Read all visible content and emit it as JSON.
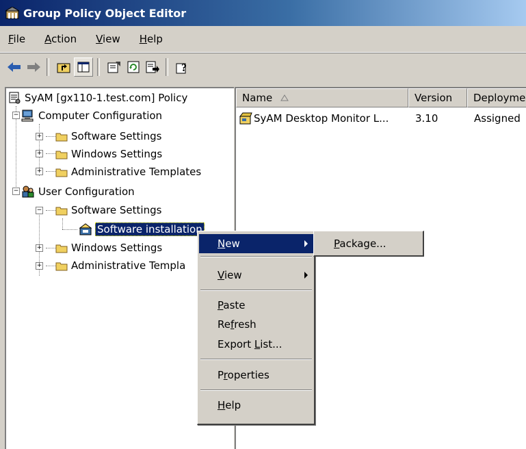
{
  "window": {
    "title": "Group Policy Object Editor"
  },
  "menubar": {
    "file": {
      "pre": "",
      "u": "F",
      "post": "ile"
    },
    "action": {
      "pre": "",
      "u": "A",
      "post": "ction"
    },
    "view": {
      "pre": "",
      "u": "V",
      "post": "iew"
    },
    "help": {
      "pre": "",
      "u": "H",
      "post": "elp"
    }
  },
  "toolbar": {
    "buttons": [
      "back-icon",
      "forward-icon",
      "up-level-icon",
      "show-hide-tree-icon",
      "properties-icon",
      "refresh-icon",
      "export-list-icon",
      "help-icon"
    ]
  },
  "tree": {
    "root": "SyAM [gx110-1.test.com] Policy",
    "computer_config": "Computer Configuration",
    "cc_software": "Software Settings",
    "cc_windows": "Windows Settings",
    "cc_admin": "Administrative Templates",
    "user_config": "User Configuration",
    "uc_software": "Software Settings",
    "uc_software_install": "Software installation",
    "uc_windows": "Windows Settings",
    "uc_admin": "Administrative Templa"
  },
  "list": {
    "columns": {
      "name": "Name",
      "version": "Version",
      "deployment": "Deployme"
    },
    "rows": [
      {
        "name": "SyAM Desktop Monitor L...",
        "version": "3.10",
        "deployment": "Assigned"
      }
    ]
  },
  "context_menu": {
    "new": {
      "pre": "",
      "u": "N",
      "post": "ew"
    },
    "view": {
      "pre": "",
      "u": "V",
      "post": "iew"
    },
    "paste": {
      "pre": "",
      "u": "P",
      "post": "aste"
    },
    "refresh": {
      "pre": "Re",
      "u": "f",
      "post": "resh"
    },
    "export": {
      "pre": "Export ",
      "u": "L",
      "post": "ist..."
    },
    "properties": {
      "pre": "P",
      "u": "r",
      "post": "operties"
    },
    "help": {
      "pre": "",
      "u": "H",
      "post": "elp"
    }
  },
  "submenu": {
    "package": {
      "pre": "",
      "u": "P",
      "post": "ackage..."
    }
  },
  "colors": {
    "title_start": "#0a246a",
    "title_end": "#a6caf0",
    "highlight": "#0a246a",
    "face": "#d4d0c8"
  }
}
